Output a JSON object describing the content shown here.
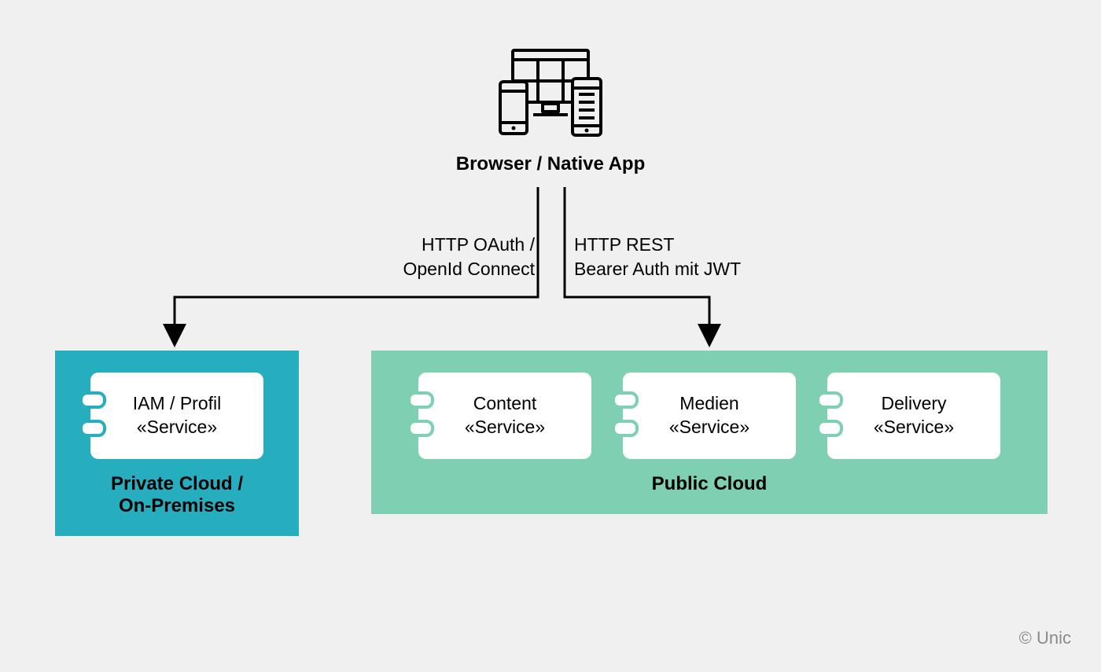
{
  "client": {
    "label": "Browser / Native App",
    "icon_name": "devices-icon"
  },
  "connections": {
    "left": {
      "line1": "HTTP OAuth /",
      "line2": "OpenId Connect"
    },
    "right": {
      "line1": "HTTP REST",
      "line2": "Bearer Auth mit JWT"
    }
  },
  "clouds": {
    "private": {
      "title_line1": "Private Cloud /",
      "title_line2": "On-Premises",
      "color": "#26aebf",
      "services": [
        {
          "name_line1": "IAM / Profil",
          "name_line2": "«Service»"
        }
      ]
    },
    "public": {
      "title": "Public Cloud",
      "color": "#7fcfb2",
      "services": [
        {
          "name_line1": "Content",
          "name_line2": "«Service»"
        },
        {
          "name_line1": "Medien",
          "name_line2": "«Service»"
        },
        {
          "name_line1": "Delivery",
          "name_line2": "«Service»"
        }
      ]
    }
  },
  "footer": {
    "copyright": "© Unic"
  }
}
